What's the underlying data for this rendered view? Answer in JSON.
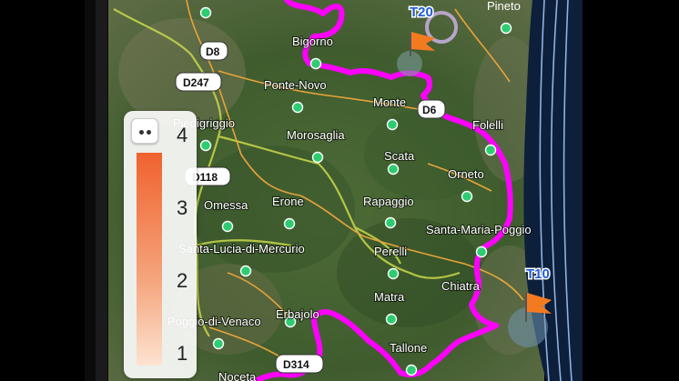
{
  "map": {
    "places": [
      "Bigorno",
      "Ponte-Novo",
      "Monte",
      "Folelli",
      "Morosaglia",
      "Scata",
      "Orneto",
      "Erone",
      "Rapaggio",
      "Santa-Maria-Poggio",
      "Perelli",
      "Omessa",
      "Santa-Lucia-di-Mercurio",
      "Chiatra",
      "Matra",
      "Erbajolo",
      "Tallone",
      "Poggio-di-Venaco",
      "Pineto",
      "Piedigriggio",
      "Noceta"
    ],
    "roads": [
      "D8",
      "D247",
      "D6",
      "D118",
      "D314"
    ],
    "waypoints": [
      "T20",
      "T10"
    ],
    "colors": {
      "track": "#ff00ff",
      "roads": "#e8a33a",
      "borders": "#c9d84a",
      "poi": "#2ecc71",
      "waypoint": "#1e5bd8",
      "flag": "#f47a20"
    }
  },
  "legend": {
    "ticks": [
      "4",
      "3",
      "2",
      "1"
    ],
    "gradient": [
      "#f0622e",
      "#fde3d1"
    ]
  }
}
